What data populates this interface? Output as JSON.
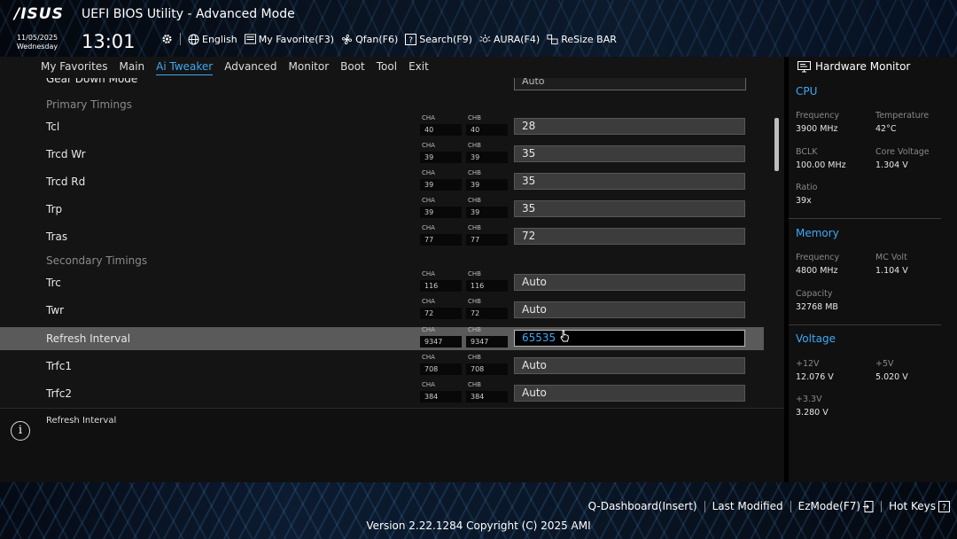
{
  "header": {
    "logo": "/ISUS",
    "title": "UEFI BIOS Utility - Advanced Mode",
    "date": "11/05/2025",
    "weekday": "Wednesday",
    "time": "13:01"
  },
  "toolbar": {
    "language": "English",
    "favorite": "My Favorite(F3)",
    "qfan": "Qfan(F6)",
    "search": "Search(F9)",
    "aura": "AURA(F4)",
    "resizebar": "ReSize BAR"
  },
  "nav": [
    "My Favorites",
    "Main",
    "Ai Tweaker",
    "Advanced",
    "Monitor",
    "Boot",
    "Tool",
    "Exit"
  ],
  "nav_active": "Ai Tweaker",
  "partial_row": {
    "label": "Gear Down Mode",
    "value": "Auto"
  },
  "rows": [
    {
      "type": "section",
      "label": "Primary Timings"
    },
    {
      "type": "timing",
      "label": "Tcl",
      "cha_tag": "CHA",
      "chb_tag": "CHB",
      "cha": "40",
      "chb": "40",
      "value": "28"
    },
    {
      "type": "timing",
      "label": "Trcd Wr",
      "cha_tag": "CHA",
      "chb_tag": "CHB",
      "cha": "39",
      "chb": "39",
      "value": "35"
    },
    {
      "type": "timing",
      "label": "Trcd Rd",
      "cha_tag": "CHA",
      "chb_tag": "CHB",
      "cha": "39",
      "chb": "39",
      "value": "35"
    },
    {
      "type": "timing",
      "label": "Trp",
      "cha_tag": "CHA",
      "chb_tag": "CHB",
      "cha": "39",
      "chb": "39",
      "value": "35"
    },
    {
      "type": "timing",
      "label": "Tras",
      "cha_tag": "CHA",
      "chb_tag": "CHB",
      "cha": "77",
      "chb": "77",
      "value": "72"
    },
    {
      "type": "section",
      "label": "Secondary Timings"
    },
    {
      "type": "timing",
      "label": "Trc",
      "cha_tag": "CHA",
      "chb_tag": "CHB",
      "cha": "116",
      "chb": "116",
      "value": "Auto"
    },
    {
      "type": "timing",
      "label": "Twr",
      "cha_tag": "CHA",
      "chb_tag": "CHB",
      "cha": "72",
      "chb": "72",
      "value": "Auto"
    },
    {
      "type": "timing",
      "label": "Refresh Interval",
      "cha_tag": "CHA",
      "chb_tag": "CHB",
      "cha": "9347",
      "chb": "9347",
      "value": "65535",
      "selected": true
    },
    {
      "type": "timing",
      "label": "Trfc1",
      "cha_tag": "CHA",
      "chb_tag": "CHB",
      "cha": "708",
      "chb": "708",
      "value": "Auto"
    },
    {
      "type": "timing",
      "label": "Trfc2",
      "cha_tag": "CHA",
      "chb_tag": "CHB",
      "cha": "384",
      "chb": "384",
      "value": "Auto"
    }
  ],
  "help": {
    "text": "Refresh Interval"
  },
  "hw": {
    "title": "Hardware Monitor",
    "cpu": {
      "title": "CPU",
      "freq_k": "Frequency",
      "freq_v": "3900 MHz",
      "temp_k": "Temperature",
      "temp_v": "42°C",
      "bclk_k": "BCLK",
      "bclk_v": "100.00 MHz",
      "cv_k": "Core Voltage",
      "cv_v": "1.304 V",
      "ratio_k": "Ratio",
      "ratio_v": "39x"
    },
    "memory": {
      "title": "Memory",
      "freq_k": "Frequency",
      "freq_v": "4800 MHz",
      "mc_k": "MC Volt",
      "mc_v": "1.104 V",
      "cap_k": "Capacity",
      "cap_v": "32768 MB"
    },
    "voltage": {
      "title": "Voltage",
      "v12_k": "+12V",
      "v12_v": "12.076 V",
      "v5_k": "+5V",
      "v5_v": "5.020 V",
      "v33_k": "+3.3V",
      "v33_v": "3.280 V"
    }
  },
  "footer": {
    "qdash": "Q-Dashboard(Insert)",
    "lastmod": "Last Modified",
    "ezmode": "EzMode(F7)",
    "hotkeys": "Hot Keys",
    "version": "Version 2.22.1284 Copyright (C) 2025 AMI"
  },
  "colors": {
    "accent": "#3fa9f5",
    "panel": "#141414",
    "selected_row": "#5a5a5a"
  }
}
